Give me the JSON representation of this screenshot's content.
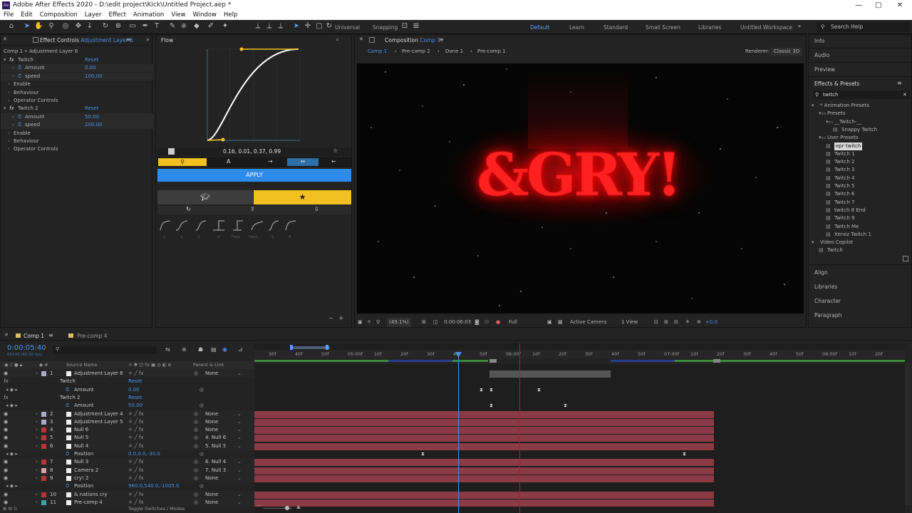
{
  "window": {
    "title": "Adobe After Effects 2020 - D:\\edit project\\Kick\\Untitled Project.aep *"
  },
  "menu": [
    "File",
    "Edit",
    "Composition",
    "Layer",
    "Effect",
    "Animation",
    "View",
    "Window",
    "Help"
  ],
  "toolbar": {
    "universal": "Universal",
    "snapping": "Snapping",
    "workspaces": [
      "Default",
      "Learn",
      "Standard",
      "Small Screen",
      "Libraries",
      "Untitled Workspace"
    ],
    "search_help": "Search Help"
  },
  "effect_controls": {
    "tab_label": "Effect Controls",
    "tab_layer": "Adjustment Layer 6",
    "header": "Comp 1 • Adjustment Layer 6",
    "rows": [
      {
        "indent": 0,
        "label": "Twitch",
        "value": "Reset",
        "fx": true
      },
      {
        "indent": 2,
        "label": "Amount",
        "value": "0.00",
        "stop": true
      },
      {
        "indent": 2,
        "label": "speed",
        "value": "100.00",
        "stop": true
      },
      {
        "indent": 1,
        "label": "Enable",
        "value": ""
      },
      {
        "indent": 1,
        "label": "Behaviour",
        "value": ""
      },
      {
        "indent": 1,
        "label": "Operator Controls",
        "value": ""
      },
      {
        "indent": 0,
        "label": "Twitch 2",
        "value": "Reset",
        "fx": true
      },
      {
        "indent": 2,
        "label": "Amount",
        "value": "50.00",
        "stop": true
      },
      {
        "indent": 2,
        "label": "speed",
        "value": "200.00",
        "stop": true
      },
      {
        "indent": 1,
        "label": "Enable",
        "value": ""
      },
      {
        "indent": 1,
        "label": "Behaviour",
        "value": ""
      },
      {
        "indent": 1,
        "label": "Operator Controls",
        "value": ""
      }
    ]
  },
  "flow": {
    "tab": "Flow",
    "bezier": "0.16, 0.01, 0.37, 0.99",
    "apply": "APPLY",
    "preset_nums": [
      "1",
      "2",
      "3",
      "4",
      "Fake",
      "Fake...",
      "5",
      "6"
    ]
  },
  "composition": {
    "tab": "Composition",
    "tab_comp": "Comp 1",
    "breadcrumbs": [
      "Comp 1",
      "Pre-comp 2",
      "Done 1",
      "Pre-comp 1"
    ],
    "renderer_label": "Renderer:",
    "renderer": "Classic 3D",
    "viewer_text": "&GRY!",
    "footer": {
      "zoom": "(49.1%)",
      "time": "0:00:06:03",
      "quality": "Full",
      "camera": "Active Camera",
      "views": "1 View",
      "exposure": "+0.0"
    }
  },
  "right_panel": {
    "sections_top": [
      "Info",
      "Audio",
      "Preview"
    ],
    "effects_title": "Effects & Presets",
    "search": "twitch",
    "tree": [
      {
        "indent": 0,
        "text": "* Animation Presets",
        "kind": "folder-open"
      },
      {
        "indent": 1,
        "text": "Presets",
        "kind": "folder"
      },
      {
        "indent": 2,
        "text": "__Twitch-__",
        "kind": "folder"
      },
      {
        "indent": 3,
        "text": "Snappy Twitch",
        "kind": "file"
      },
      {
        "indent": 1,
        "text": "User Presets",
        "kind": "folder"
      },
      {
        "indent": 2,
        "text": "epr twitch",
        "kind": "file",
        "selected": true
      },
      {
        "indent": 2,
        "text": "Twitch 1",
        "kind": "file"
      },
      {
        "indent": 2,
        "text": "Twitch 2",
        "kind": "file"
      },
      {
        "indent": 2,
        "text": "Twitch 3",
        "kind": "file"
      },
      {
        "indent": 2,
        "text": "Twitch 4",
        "kind": "file"
      },
      {
        "indent": 2,
        "text": "Twitch 5",
        "kind": "file"
      },
      {
        "indent": 2,
        "text": "Twitch 6",
        "kind": "file"
      },
      {
        "indent": 2,
        "text": "Twitch 7",
        "kind": "file"
      },
      {
        "indent": 2,
        "text": "twitch 8 End",
        "kind": "file"
      },
      {
        "indent": 2,
        "text": "Twitch 9",
        "kind": "file"
      },
      {
        "indent": 2,
        "text": "Twitch Me",
        "kind": "file"
      },
      {
        "indent": 2,
        "text": "Xenoz Twitch 1",
        "kind": "file"
      },
      {
        "indent": 0,
        "text": "Video Copilot",
        "kind": "folder-open"
      },
      {
        "indent": 1,
        "text": "Twitch",
        "kind": "file"
      }
    ],
    "sections_bottom": [
      "Align",
      "Libraries",
      "Character",
      "Paragraph"
    ]
  },
  "timeline": {
    "tabs": [
      "Comp 1",
      "Pre-comp 4"
    ],
    "timecode": "0:00:05:40",
    "fps": "00140 (60.00 fps)",
    "header": {
      "source": "Source Name",
      "parent": "Parent & Link"
    },
    "ruler": [
      "30f",
      "40f",
      "50f",
      "05:00f",
      "10f",
      "20f",
      "30f",
      "40f",
      "50f",
      "06:00f",
      "10f",
      "20f",
      "30f",
      "40f",
      "50f",
      "07:00f",
      "10f",
      "20f",
      "30f",
      "40f",
      "50f",
      "08:00f",
      "10f",
      "20f"
    ],
    "layers": [
      {
        "type": "layer",
        "num": "1",
        "name": "Adjustment Layer 6",
        "color": "#a9a9c9",
        "parent": "None",
        "bar": "gray"
      },
      {
        "type": "sub",
        "name": "Twitch",
        "value": "Reset"
      },
      {
        "type": "prop",
        "name": "Amount",
        "value": "0.00"
      },
      {
        "type": "sub",
        "name": "Twitch 2",
        "value": "Reset"
      },
      {
        "type": "prop",
        "name": "Amount",
        "value": "50.00"
      },
      {
        "type": "layer",
        "num": "2",
        "name": "Adjustment Layer 4",
        "color": "#a9a9c9",
        "parent": "None"
      },
      {
        "type": "layer",
        "num": "3",
        "name": "Adjustment Layer 5",
        "color": "#a9a9c9",
        "parent": "None"
      },
      {
        "type": "layer",
        "num": "4",
        "name": "Null 6",
        "color": "#b03838",
        "parent": "None"
      },
      {
        "type": "layer",
        "num": "5",
        "name": "Null 5",
        "color": "#b03838",
        "parent": "4. Null 6"
      },
      {
        "type": "layer",
        "num": "6",
        "name": "Null 4",
        "color": "#b03838",
        "parent": "5. Null 5"
      },
      {
        "type": "prop",
        "name": "Position",
        "value": "0.0,0.0,-30.0"
      },
      {
        "type": "layer",
        "num": "7",
        "name": "Null 3",
        "color": "#b03838",
        "parent": "6. Null 4"
      },
      {
        "type": "layer",
        "num": "8",
        "name": "Camera 2",
        "color": "#d9a0a8",
        "parent": "7. Null 3"
      },
      {
        "type": "layer",
        "num": "9",
        "name": "cry! 2",
        "color": "#b03838",
        "parent": "None"
      },
      {
        "type": "prop",
        "name": "Position",
        "value": "960.0,540.0,-1005.0"
      },
      {
        "type": "layer",
        "num": "10",
        "name": "& nations cry",
        "color": "#b03838",
        "parent": "None"
      },
      {
        "type": "layer",
        "num": "11",
        "name": "Pre-comp 4",
        "color": "#40a0a0",
        "parent": "None"
      }
    ],
    "footer": "Toggle Switches / Modes"
  },
  "colors": {
    "accent_blue": "#2d8ceb",
    "yellow": "#f3c021",
    "playhead": "#4a8fe5",
    "layer_red": "#8a3b45"
  }
}
